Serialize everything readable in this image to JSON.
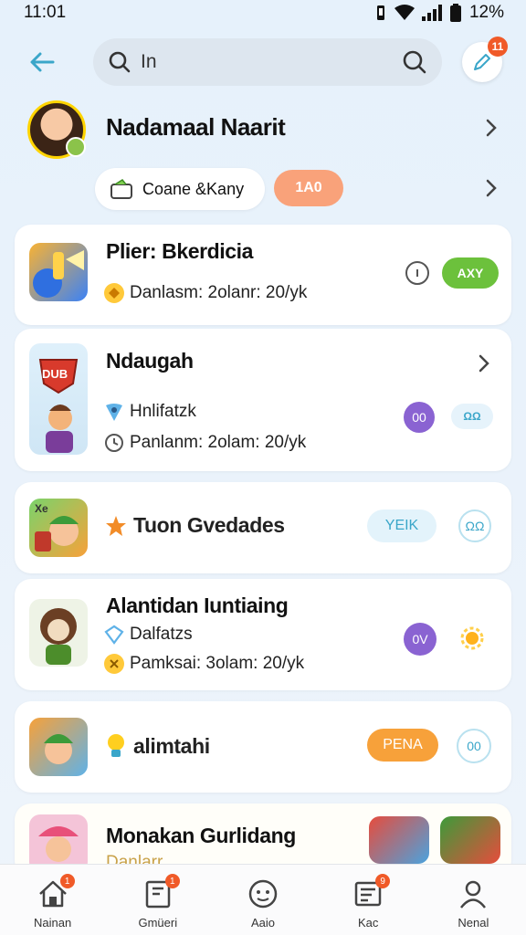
{
  "status_bar": {
    "time": "11:01",
    "battery": "12%"
  },
  "search": {
    "query": "In"
  },
  "compose": {
    "badge": "11"
  },
  "profile": {
    "name": "Nadamaal Naarit",
    "chip_label": "Coane &Kany",
    "pill_label": "1A0"
  },
  "cards": [
    {
      "title": "Plier: Bkerdicia",
      "meta": "Danlasm: 2olanr: 20/yk",
      "action_label": "AXY"
    },
    {
      "title": "Ndaugah",
      "icon_text": "DUB",
      "sub": "Hnlifatzk",
      "meta": "Panlanm: 2olam: 20/yk",
      "btn1": "00",
      "btn2": "ΩΩ"
    },
    {
      "title": "Tuon Gvedades",
      "icon_text": "Xe",
      "action_label": "YEIK",
      "btn": "ΩΩ"
    },
    {
      "title": "Alantidan Iuntiaing",
      "sub": "Dalfatzs",
      "meta": "Pamksai: 3olam: 20/yk",
      "btn1": "0V"
    },
    {
      "title": "alimtahi",
      "action_label": "PENA",
      "btn": "00"
    },
    {
      "title": "Monakan Gurlidang",
      "sub": "Danlarr"
    }
  ],
  "nav": [
    {
      "label": "Nainan",
      "icon": "home-icon",
      "badge": "1"
    },
    {
      "label": "Gmüeri",
      "icon": "library-icon",
      "badge": "1"
    },
    {
      "label": "Aaio",
      "icon": "face-icon",
      "badge": ""
    },
    {
      "label": "Kac",
      "icon": "inbox-icon",
      "badge": "9"
    },
    {
      "label": "Nenal",
      "icon": "person-icon",
      "badge": ""
    }
  ],
  "colors": {
    "accent_green": "#6cc13c",
    "accent_orange": "#f7a13a",
    "accent_purple": "#8a63d2",
    "accent_blue": "#3aa6c9",
    "badge_red": "#f05a28"
  }
}
